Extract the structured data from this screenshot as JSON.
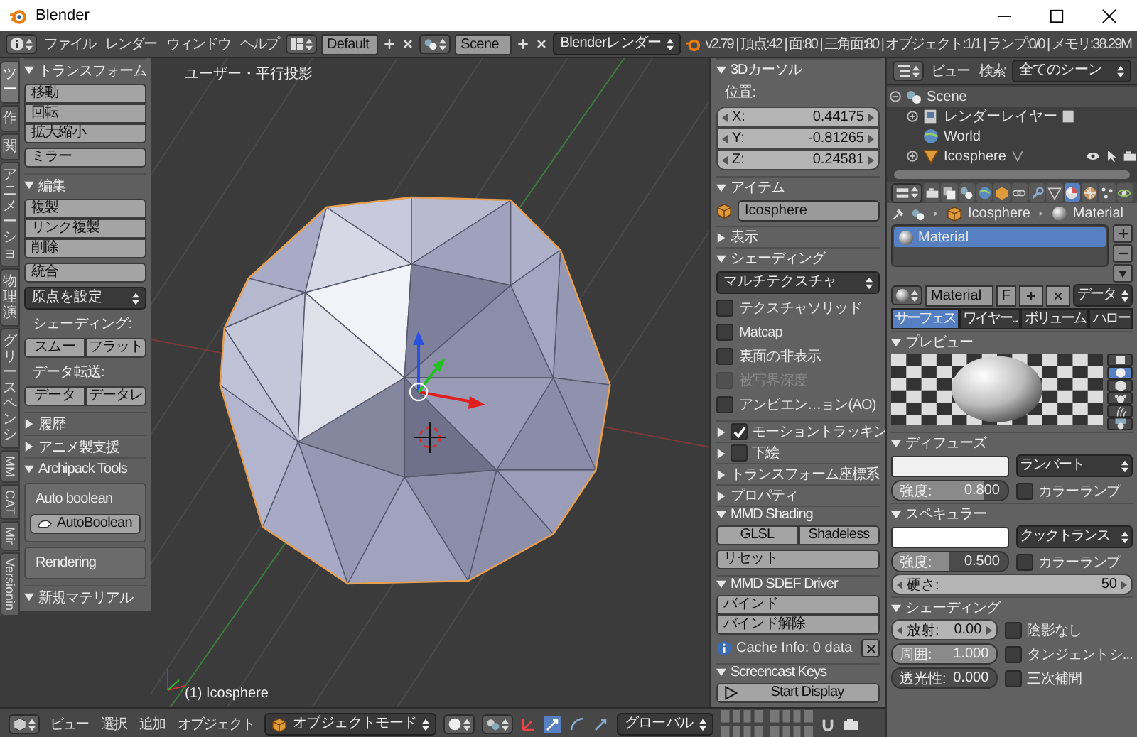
{
  "window": {
    "title": "Blender"
  },
  "info_header": {
    "menus": [
      "ファイル",
      "レンダー",
      "ウィンドウ",
      "ヘルプ"
    ],
    "screen_layout": "Default",
    "scene": "Scene",
    "render_engine": "Blenderレンダー",
    "stats": "v2.79 | 頂点:42 | 面:80 | 三角面:80 | オブジェクト:1/1 | ランプ:0/0 | メモリ:38.29M"
  },
  "tool_tabs": [
    {
      "label": "ツー",
      "kind": "stacked",
      "selected": true
    },
    {
      "label": "作",
      "kind": "stacked",
      "selected": false
    },
    {
      "label": "関",
      "kind": "stacked",
      "selected": false
    },
    {
      "label": "アニメーショ",
      "kind": "stacked",
      "selected": false
    },
    {
      "label": "物理演",
      "kind": "stacked",
      "selected": false
    },
    {
      "label": "グリースペンシ",
      "kind": "stacked",
      "selected": false
    },
    {
      "label": "MM",
      "kind": "rotated",
      "selected": false
    },
    {
      "label": "CAT",
      "kind": "rotated",
      "selected": false
    },
    {
      "label": "Mir",
      "kind": "rotated",
      "selected": false
    },
    {
      "label": "Versionin",
      "kind": "rotated",
      "selected": false
    }
  ],
  "tool_shelf": [
    {
      "title": "トランスフォーム",
      "expanded": true,
      "items": [
        {
          "kind": "stack",
          "labels": [
            "移動",
            "回転",
            "拡大縮小"
          ]
        },
        {
          "kind": "button",
          "label": "ミラー"
        }
      ]
    },
    {
      "title": "編集",
      "expanded": true,
      "items": [
        {
          "kind": "stack",
          "labels": [
            "複製",
            "リンク複製",
            "削除"
          ]
        },
        {
          "kind": "button",
          "label": "統合"
        },
        {
          "kind": "dropdown",
          "label": "原点を設定"
        },
        {
          "kind": "label",
          "label": "シェーディング:"
        },
        {
          "kind": "pair",
          "labels": [
            "スムー",
            "フラット"
          ]
        },
        {
          "kind": "label",
          "label": "データ転送:"
        },
        {
          "kind": "pair",
          "labels": [
            "データ",
            "データレ"
          ]
        }
      ]
    },
    {
      "title": "履歴",
      "expanded": false
    },
    {
      "title": "アニメ製支援",
      "expanded": false
    },
    {
      "title": "Archipack Tools",
      "expanded": true,
      "items": [
        {
          "kind": "box",
          "label": "Auto boolean",
          "button": "AutoBoolean"
        },
        {
          "kind": "box",
          "label": "Rendering"
        }
      ]
    },
    {
      "title": "新規マテリアル",
      "expanded": true
    }
  ],
  "viewport": {
    "view_label": "ユーザー・平行投影",
    "object_label": "(1) Icosphere"
  },
  "sidebar": [
    {
      "title": "3Dカーソル",
      "expanded": true,
      "items": [
        {
          "kind": "label",
          "label": "位置:"
        },
        {
          "kind": "vector",
          "fields": [
            {
              "axis": "X:",
              "value": "0.44175"
            },
            {
              "axis": "Y:",
              "value": "-0.81265"
            },
            {
              "axis": "Z:",
              "value": "0.24581"
            }
          ]
        }
      ]
    },
    {
      "title": "アイテム",
      "expanded": true,
      "items": [
        {
          "kind": "name",
          "value": "Icosphere"
        }
      ]
    },
    {
      "title": "表示",
      "expanded": false
    },
    {
      "title": "シェーディング",
      "expanded": true,
      "items": [
        {
          "kind": "dropdown",
          "label": "マルチテクスチャ"
        },
        {
          "kind": "checkbox",
          "label": "テクスチャソリッド",
          "checked": false,
          "disabled": false
        },
        {
          "kind": "checkbox",
          "label": "Matcap",
          "checked": false,
          "disabled": false
        },
        {
          "kind": "checkbox",
          "label": "裏面の非表示",
          "checked": false,
          "disabled": false
        },
        {
          "kind": "checkbox",
          "label": "被写界深度",
          "checked": false,
          "disabled": true
        },
        {
          "kind": "checkbox",
          "label": "アンビエン…ョン(AO)",
          "checked": false,
          "disabled": false
        }
      ]
    },
    {
      "title": "モーショントラッキン",
      "expanded": false,
      "checked": true
    },
    {
      "title": "下絵",
      "expanded": false,
      "checked": false
    },
    {
      "title": "トランスフォーム座標系",
      "expanded": false
    },
    {
      "title": "プロパティ",
      "expanded": false
    },
    {
      "title": "MMD Shading",
      "expanded": true,
      "items": [
        {
          "kind": "pair",
          "labels": [
            "GLSL",
            "Shadeless"
          ]
        },
        {
          "kind": "button",
          "label": "リセット"
        }
      ]
    },
    {
      "title": "MMD SDEF Driver",
      "expanded": true,
      "items": [
        {
          "kind": "stack",
          "labels": [
            "バインド",
            "バインド解除"
          ]
        },
        {
          "kind": "info",
          "label": "Cache Info: 0 data"
        }
      ]
    },
    {
      "title": "Screencast Keys",
      "expanded": true,
      "items": [
        {
          "kind": "play",
          "label": "Start Display"
        }
      ]
    }
  ],
  "outliner": {
    "view_menu": "ビュー",
    "search_menu": "検索",
    "filter": "全てのシーン",
    "tree": [
      {
        "label": "Scene",
        "kind": "scene",
        "expanded": true,
        "children": [
          {
            "label": "レンダーレイヤー",
            "kind": "render_layer",
            "expanded": false
          },
          {
            "label": "World",
            "kind": "world"
          },
          {
            "label": "Icosphere",
            "kind": "mesh",
            "expanded": false
          }
        ]
      }
    ]
  },
  "properties": {
    "tabs": [
      {
        "kind": "render",
        "selected": false
      },
      {
        "kind": "render_layer",
        "selected": false
      },
      {
        "kind": "scene",
        "selected": false
      },
      {
        "kind": "world",
        "selected": false
      },
      {
        "kind": "object",
        "selected": false
      },
      {
        "kind": "constraints",
        "selected": false
      },
      {
        "kind": "modifiers",
        "selected": false
      },
      {
        "kind": "data",
        "selected": false
      },
      {
        "kind": "material",
        "selected": true
      },
      {
        "kind": "texture",
        "selected": false
      },
      {
        "kind": "particles",
        "selected": false
      },
      {
        "kind": "physics",
        "selected": false
      }
    ],
    "breadcrumb": [
      "Icosphere",
      "Material"
    ],
    "material_slots": [
      {
        "label": "Material",
        "selected": true
      }
    ],
    "datablock": {
      "name": "Material",
      "fake_user": "F",
      "link": "データ"
    },
    "subtabs": [
      {
        "label": "サーフェス",
        "selected": true
      },
      {
        "label": "ワイヤー...",
        "selected": false
      },
      {
        "label": "ボリューム",
        "selected": false
      },
      {
        "label": "ハロー",
        "selected": false
      }
    ],
    "preview": {
      "title": "プレビュー",
      "expanded": true,
      "shapes": [
        {
          "kind": "flat",
          "selected": false
        },
        {
          "kind": "sphere",
          "selected": true
        },
        {
          "kind": "cube",
          "selected": false
        },
        {
          "kind": "monkey",
          "selected": false
        },
        {
          "kind": "hair",
          "selected": false
        },
        {
          "kind": "sky",
          "selected": false
        }
      ]
    },
    "diffuse": {
      "title": "ディフューズ",
      "expanded": true,
      "color": "#f0f0f0",
      "shader": "ランバート",
      "intensity_label": "強度:",
      "intensity": "0.800",
      "level": 0.8,
      "ramp_label": "カラーランプ",
      "ramp": false
    },
    "specular": {
      "title": "スペキュラー",
      "expanded": true,
      "color": "#ffffff",
      "shader": "クックトランス",
      "intensity_label": "強度:",
      "intensity": "0.500",
      "level": 0.5,
      "ramp_label": "カラーランプ",
      "ramp": false,
      "hardness_label": "硬さ:",
      "hardness": "50"
    },
    "shading": {
      "title": "シェーディング",
      "expanded": true,
      "fields": [
        {
          "kind": "number",
          "label": "放射:",
          "value": "0.00"
        },
        {
          "kind": "slider",
          "label": "周囲:",
          "value": "1.000",
          "level": 1
        },
        {
          "kind": "slider",
          "label": "透光性:",
          "value": "0.000",
          "level": 0
        }
      ],
      "options": [
        {
          "label": "陰影なし",
          "checked": false
        },
        {
          "label": "タンジェントシ...",
          "checked": false
        },
        {
          "label": "三次補間",
          "checked": false
        }
      ]
    }
  },
  "bottom_header": {
    "menus": [
      "ビュー",
      "選択",
      "追加",
      "オブジェクト"
    ],
    "mode": "オブジェクトモード",
    "orientation": "グローバル"
  }
}
